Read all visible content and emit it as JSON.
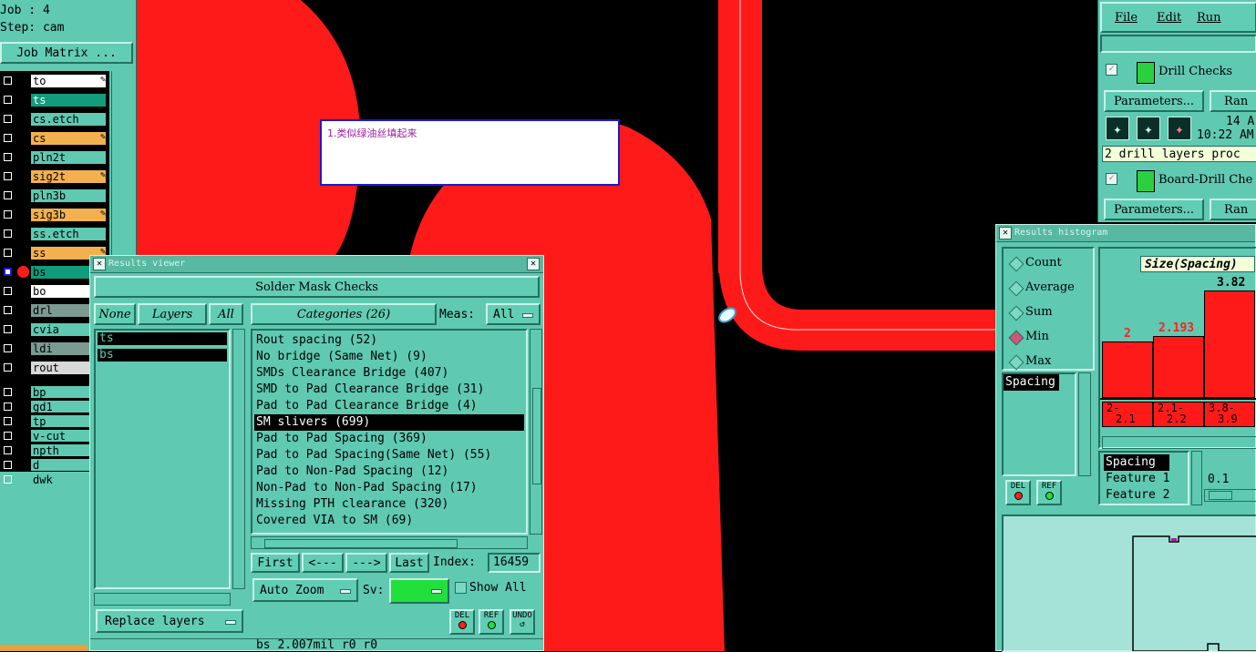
{
  "colors": {
    "panel": "#5fc9b1",
    "red": "#ff1a1a",
    "canvas": "#000000",
    "green": "#22e03c"
  },
  "job": {
    "job_label": "Job : 4",
    "step_label": "Step: cam",
    "matrix_button": "Job Matrix ..."
  },
  "layers": [
    {
      "name": "to",
      "bg": "#ffffff",
      "edit": true
    },
    {
      "name": "ts",
      "bg": "#119c7c",
      "edit": false,
      "fg": "#ffffff"
    },
    {
      "name": "cs.etch",
      "bg": "#5fc9b1",
      "edit": false
    },
    {
      "name": "cs",
      "bg": "#f3b04e",
      "edit": true
    },
    {
      "name": "pln2t",
      "bg": "#5fc9b1",
      "edit": false
    },
    {
      "name": "sig2t",
      "bg": "#f3b04e",
      "edit": true
    },
    {
      "name": "pln3b",
      "bg": "#5fc9b1",
      "edit": false
    },
    {
      "name": "sig3b",
      "bg": "#f3b04e",
      "edit": true
    },
    {
      "name": "ss.etch",
      "bg": "#5fc9b1",
      "edit": false
    },
    {
      "name": "ss",
      "bg": "#f3b04e",
      "edit": true
    },
    {
      "name": "bs",
      "bg": "#119c7c",
      "edit": false,
      "fg": "#000000"
    },
    {
      "name": "bo",
      "bg": "#ffffff",
      "edit": false
    },
    {
      "name": "drl",
      "bg": "#7a9a92",
      "edit": false
    },
    {
      "name": "cvia",
      "bg": "#5fc9b1",
      "edit": false
    },
    {
      "name": "ldi",
      "bg": "#7a9a92",
      "edit": false
    },
    {
      "name": "rout",
      "bg": "#d8d8d8",
      "edit": false
    },
    {
      "name": "bp",
      "bg": "#5fc9b1",
      "edit": false
    },
    {
      "name": "gd1",
      "bg": "#5fc9b1",
      "edit": false
    },
    {
      "name": "tp",
      "bg": "#5fc9b1",
      "edit": false
    },
    {
      "name": "v-cut",
      "bg": "#5fc9b1",
      "edit": false
    },
    {
      "name": "npth",
      "bg": "#5fc9b1",
      "edit": false
    },
    {
      "name": "d",
      "bg": "#5fc9b1",
      "edit": false
    },
    {
      "name": "dwk",
      "bg": "#5fc9b1",
      "edit": false
    }
  ],
  "note": {
    "text": "1.类似绿油丝填起来"
  },
  "viewer": {
    "title": "Results viewer",
    "header": "Solder Mask Checks",
    "none_label": "None",
    "layers_label": "Layers",
    "all_label": "All",
    "categories_label": "Categories (26)",
    "meas_label": "Meas:",
    "meas_value": "All",
    "layer_items": [
      "ts",
      "bs"
    ],
    "categories": [
      "Rout spacing (52)",
      "No bridge (Same Net) (9)",
      "SMDs Clearance Bridge (407)",
      "SMD to Pad Clearance Bridge (31)",
      "Pad to Pad Clearance Bridge (4)",
      "SM slivers (699)",
      "Pad to Pad Spacing (369)",
      "Pad to Pad Spacing(Same Net) (55)",
      "Pad to Non-Pad Spacing (12)",
      "Non-Pad to Non-Pad Spacing (17)",
      "Missing PTH clearance (320)",
      "Covered VIA to SM (69)"
    ],
    "selected_index": 5,
    "first": "First",
    "prev": "<---",
    "next": "--->",
    "last": "Last",
    "index_label": "Index:",
    "index_value": "16459",
    "auto_zoom": "Auto Zoom",
    "sv_label": "Sv:",
    "show_all": "Show All",
    "replace_layers": "Replace layers",
    "del": "DEL",
    "ref": "REF",
    "undo": "UNDO",
    "status": "bs 2.007mil  r0  r0"
  },
  "menu": {
    "file": "File",
    "edit": "Edit",
    "run": "Run"
  },
  "checks": [
    {
      "name": "Drill Checks",
      "params": "Parameters...",
      "run": "Ran",
      "date": "14 A",
      "time": "10:22 AM",
      "summary": "2 drill layers proc"
    },
    {
      "name": "Board-Drill Che",
      "params": "Parameters...",
      "run": "Ran"
    }
  ],
  "histogram": {
    "title": "Results histogram",
    "modes": [
      {
        "label": "Count",
        "on": false
      },
      {
        "label": "Average",
        "on": false
      },
      {
        "label": "Sum",
        "on": false
      },
      {
        "label": "Min",
        "on": true
      },
      {
        "label": "Max",
        "on": false
      }
    ],
    "list_item": "Spacing",
    "size_label": "Size(Spacing)",
    "bars": [
      {
        "value": "2",
        "range_top": "2-",
        "range_bot": "2.1"
      },
      {
        "value": "2.193",
        "range_top": "2.1-",
        "range_bot": "2.2"
      },
      {
        "value": "3.82",
        "range_top": "3.8-",
        "range_bot": "3.9"
      }
    ],
    "bar_heights": [
      2.0,
      2.193,
      3.82
    ],
    "feature_list": [
      "Spacing",
      "Feature 1",
      "Feature 2"
    ],
    "slider_value": "0.1",
    "del": "DEL",
    "ref": "REF"
  }
}
